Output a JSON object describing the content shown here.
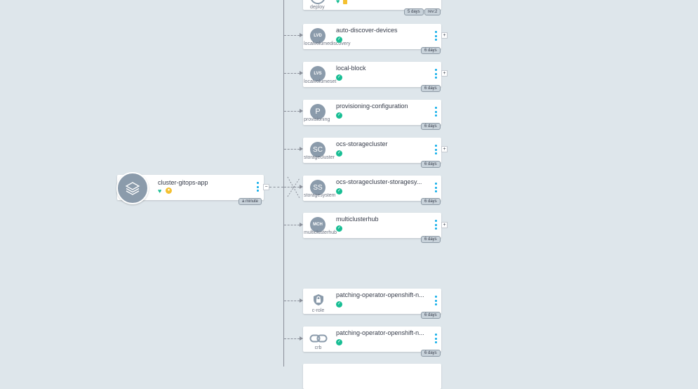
{
  "root": {
    "title": "cluster-gitops-app",
    "health_icon": "heart-icon",
    "sync_icon": "out-of-sync-icon",
    "age": "a minute",
    "collapse": "−"
  },
  "top_node": {
    "kind": "deploy",
    "badges": [
      "5 days",
      "rev:2"
    ]
  },
  "nodes": [
    {
      "id": "add",
      "title": "auto-discover-devices",
      "icon_text": "LVD",
      "kind": "localvolumediscovery",
      "age": "6 days",
      "expander": "+"
    },
    {
      "id": "lb",
      "title": "local-block",
      "icon_text": "LVS",
      "kind": "localvolumeset",
      "age": "6 days",
      "expander": "+"
    },
    {
      "id": "pc",
      "title": "provisioning-configuration",
      "icon_text": "P",
      "kind": "provisioning",
      "age": "6 days",
      "expander": ""
    },
    {
      "id": "osc",
      "title": "ocs-storagecluster",
      "icon_text": "SC",
      "kind": "storagecluster",
      "age": "6 days",
      "expander": "+"
    },
    {
      "id": "oss",
      "title": "ocs-storagecluster-storagesy...",
      "icon_text": "SS",
      "kind": "storagesystem",
      "age": "6 days",
      "expander": ""
    },
    {
      "id": "mch",
      "title": "multiclusterhub",
      "icon_text": "MCH",
      "kind": "multiclusterhub",
      "age": "6 days",
      "expander": "+"
    },
    {
      "id": "pocr",
      "title": "patching-operator-openshift-n...",
      "icon_text": "",
      "kind": "c-role",
      "age": "6 days",
      "expander": ""
    },
    {
      "id": "pocrb",
      "title": "patching-operator-openshift-n...",
      "icon_text": "",
      "kind": "crb",
      "age": "6 days",
      "expander": ""
    }
  ],
  "colors": {
    "healthy": "#18be94",
    "progressing": "#f4c030",
    "accent": "#0dadea",
    "node_icon": "#8b9bab"
  }
}
